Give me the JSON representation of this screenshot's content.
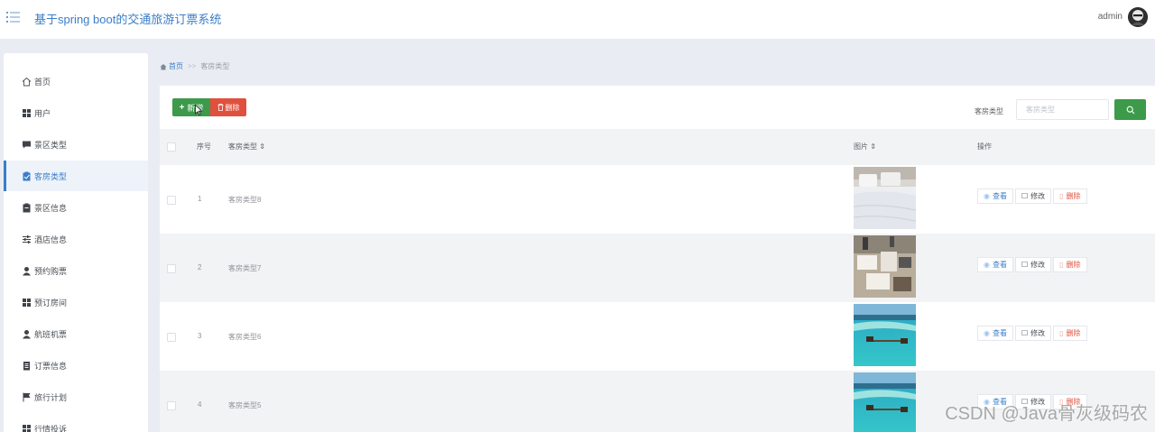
{
  "header": {
    "title": "基于spring boot的交通旅游订票系统",
    "username": "admin",
    "menu_icon": "menu-lines-icon",
    "avatar_icon": "avatar-image"
  },
  "sidebar": {
    "items": [
      {
        "label": "首页",
        "icon": "home-icon",
        "active": false
      },
      {
        "label": "用户",
        "icon": "grid-icon",
        "active": false
      },
      {
        "label": "景区类型",
        "icon": "chat-icon",
        "active": false
      },
      {
        "label": "客房类型",
        "icon": "clipboard-check-icon",
        "active": true
      },
      {
        "label": "景区信息",
        "icon": "clipboard-icon",
        "active": false
      },
      {
        "label": "酒店信息",
        "icon": "sliders-icon",
        "active": false
      },
      {
        "label": "预约购票",
        "icon": "user-icon",
        "active": false
      },
      {
        "label": "预订房间",
        "icon": "grid-icon",
        "active": false
      },
      {
        "label": "航班机票",
        "icon": "user-icon",
        "active": false
      },
      {
        "label": "订票信息",
        "icon": "document-icon",
        "active": false
      },
      {
        "label": "旅行计划",
        "icon": "flag-icon",
        "active": false
      },
      {
        "label": "行情投诉",
        "icon": "grid-icon",
        "active": false
      }
    ]
  },
  "breadcrumb": {
    "home": "首页",
    "separator": ">>",
    "current": "客房类型"
  },
  "toolbar": {
    "add_label": "新增",
    "add_icon": "plus-icon",
    "delete_label": "删除",
    "delete_icon": "trash-icon",
    "search_label": "客房类型",
    "search_placeholder": "客房类型",
    "search_icon": "search-icon"
  },
  "table": {
    "columns": {
      "index": "序号",
      "type": "客房类型 ⇕",
      "image": "图片 ⇕",
      "actions": "操作"
    },
    "rows": [
      {
        "index": "1",
        "type": "客房类型8",
        "image": "bed-photo"
      },
      {
        "index": "2",
        "type": "客房类型7",
        "image": "room-aerial-photo"
      },
      {
        "index": "3",
        "type": "客房类型6",
        "image": "sea-villa-photo"
      },
      {
        "index": "4",
        "type": "客房类型5",
        "image": "sea-villa-photo"
      }
    ],
    "actions": {
      "view": "查看",
      "edit": "修改",
      "delete": "删除"
    }
  },
  "watermark": "CSDN @Java骨灰级码农",
  "colors": {
    "accent": "#3a7ec8",
    "success": "#3c9a4a",
    "danger": "#e0503e",
    "page_bg": "#e9edf3"
  }
}
